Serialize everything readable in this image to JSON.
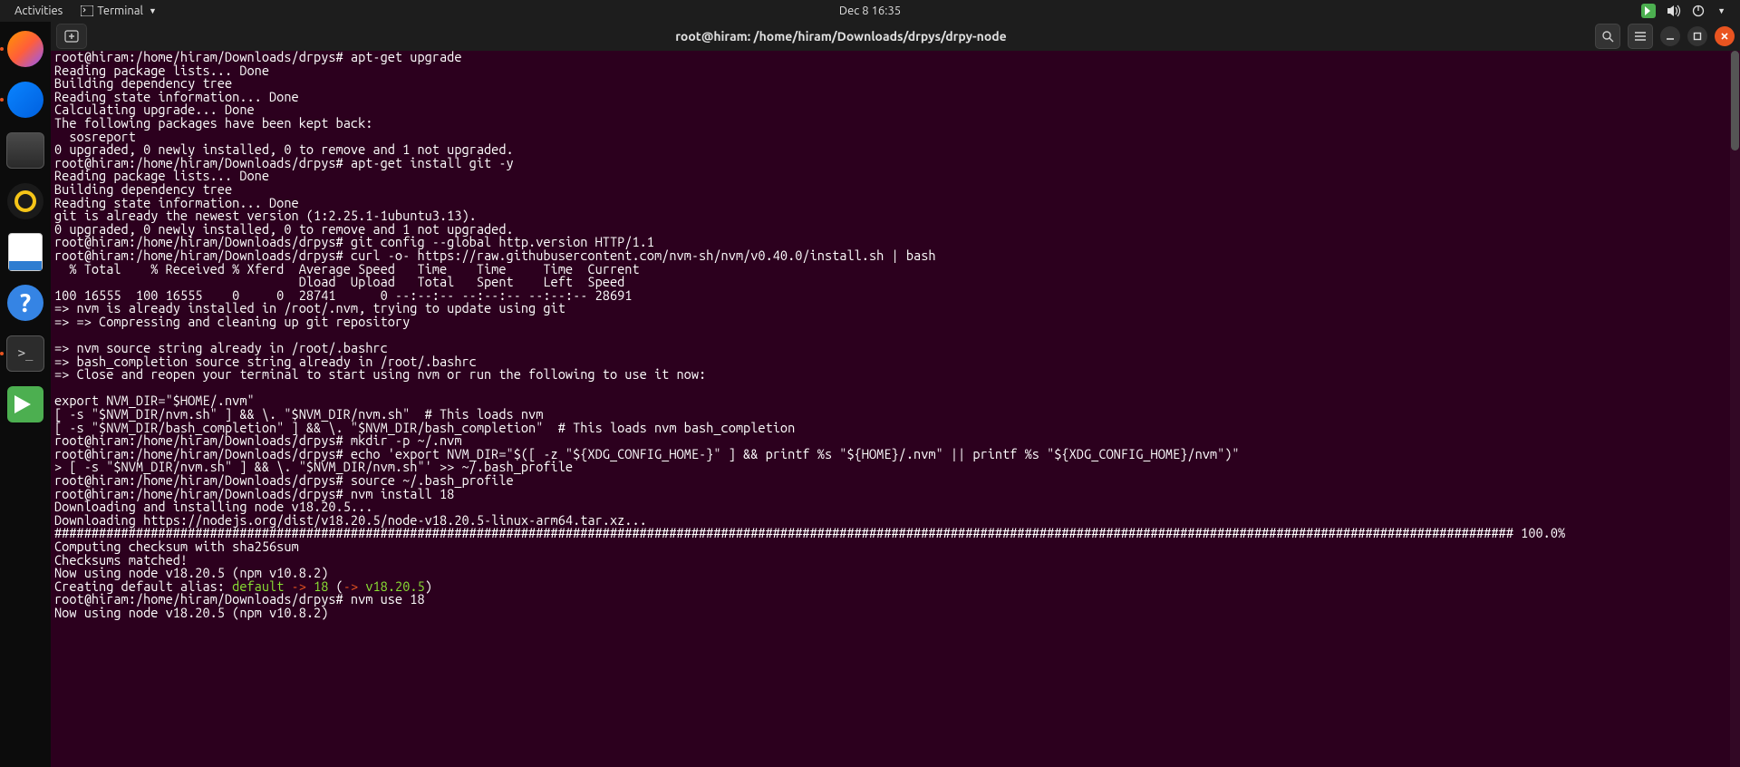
{
  "topbar": {
    "activities": "Activities",
    "app": "Terminal",
    "clock": "Dec 8  16:35"
  },
  "dock_items": [
    {
      "name": "firefox"
    },
    {
      "name": "thunderbird"
    },
    {
      "name": "files"
    },
    {
      "name": "rhythmbox"
    },
    {
      "name": "writer"
    },
    {
      "name": "help"
    },
    {
      "name": "terminal"
    },
    {
      "name": "gitkraken"
    }
  ],
  "window": {
    "title": "root@hiram: /home/hiram/Downloads/drpys/drpy-node"
  },
  "help_glyph": "?",
  "term_glyph": ">_",
  "terminal_pre": "root@hiram:/home/hiram/Downloads/drpys# apt-get upgrade\nReading package lists... Done\nBuilding dependency tree\nReading state information... Done\nCalculating upgrade... Done\nThe following packages have been kept back:\n  sosreport\n0 upgraded, 0 newly installed, 0 to remove and 1 not upgraded.\nroot@hiram:/home/hiram/Downloads/drpys# apt-get install git -y\nReading package lists... Done\nBuilding dependency tree\nReading state information... Done\ngit is already the newest version (1:2.25.1-1ubuntu3.13).\n0 upgraded, 0 newly installed, 0 to remove and 1 not upgraded.\nroot@hiram:/home/hiram/Downloads/drpys# git config --global http.version HTTP/1.1\nroot@hiram:/home/hiram/Downloads/drpys# curl -o- https://raw.githubusercontent.com/nvm-sh/nvm/v0.40.0/install.sh | bash\n  % Total    % Received % Xferd  Average Speed   Time    Time     Time  Current\n                                 Dload  Upload   Total   Spent    Left  Speed\n100 16555  100 16555    0     0  28741      0 --:--:-- --:--:-- --:--:-- 28691\n=> nvm is already installed in /root/.nvm, trying to update using git\n=> => Compressing and cleaning up git repository\n\n=> nvm source string already in /root/.bashrc\n=> bash_completion source string already in /root/.bashrc\n=> Close and reopen your terminal to start using nvm or run the following to use it now:\n\nexport NVM_DIR=\"$HOME/.nvm\"\n[ -s \"$NVM_DIR/nvm.sh\" ] && \\. \"$NVM_DIR/nvm.sh\"  # This loads nvm\n[ -s \"$NVM_DIR/bash_completion\" ] && \\. \"$NVM_DIR/bash_completion\"  # This loads nvm bash_completion\nroot@hiram:/home/hiram/Downloads/drpys# mkdir -p ~/.nvm\nroot@hiram:/home/hiram/Downloads/drpys# echo 'export NVM_DIR=\"$([ -z \"${XDG_CONFIG_HOME-}\" ] && printf %s \"${HOME}/.nvm\" || printf %s \"${XDG_CONFIG_HOME}/nvm\")\"\n> [ -s \"$NVM_DIR/nvm.sh\" ] && \\. \"$NVM_DIR/nvm.sh\"' >> ~/.bash_profile\nroot@hiram:/home/hiram/Downloads/drpys# source ~/.bash_profile\nroot@hiram:/home/hiram/Downloads/drpys# nvm install 18\nDownloading and installing node v18.20.5...\nDownloading https://nodejs.org/dist/v18.20.5/node-v18.20.5-linux-arm64.tar.xz...\n##################################################################################################################################################################################################### 100.0%\nComputing checksum with sha256sum\nChecksums matched!\nNow using node v18.20.5 (npm v10.8.2)",
  "alias_line": {
    "prefix": "Creating default alias: ",
    "default": "default",
    "arrow": " -> ",
    "eighteen": "18",
    "paren_open": " (",
    "arrow2": "-> ",
    "ver": "v18.20.5",
    "paren_close": ")"
  },
  "terminal_tail": "root@hiram:/home/hiram/Downloads/drpys# nvm use 18\nNow using node v18.20.5 (npm v10.8.2)"
}
